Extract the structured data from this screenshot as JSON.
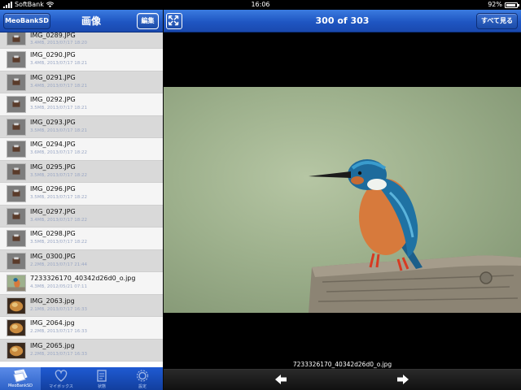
{
  "status": {
    "carrier": "SoftBank",
    "time": "16:06",
    "battery": "92%",
    "battery_level": 0.92
  },
  "left_nav": {
    "back_label": "MeoBankSD",
    "title": "画像",
    "edit_label": "編集"
  },
  "right_nav": {
    "counter": "300 of 303",
    "see_all_label": "すべて見る"
  },
  "files": [
    {
      "name": "IMG_0289.JPG",
      "meta": "3.4MB, 2013/07/17 18:20",
      "thumb": "gray"
    },
    {
      "name": "IMG_0290.JPG",
      "meta": "3.4MB, 2013/07/17 18:21",
      "thumb": "gray"
    },
    {
      "name": "IMG_0291.JPG",
      "meta": "3.4MB, 2013/07/17 18:21",
      "thumb": "gray"
    },
    {
      "name": "IMG_0292.JPG",
      "meta": "3.5MB, 2013/07/17 18:21",
      "thumb": "gray"
    },
    {
      "name": "IMG_0293.JPG",
      "meta": "3.5MB, 2013/07/17 18:21",
      "thumb": "gray"
    },
    {
      "name": "IMG_0294.JPG",
      "meta": "3.6MB, 2013/07/17 18:22",
      "thumb": "gray"
    },
    {
      "name": "IMG_0295.JPG",
      "meta": "3.5MB, 2013/07/17 18:22",
      "thumb": "gray"
    },
    {
      "name": "IMG_0296.JPG",
      "meta": "3.5MB, 2013/07/17 18:22",
      "thumb": "gray"
    },
    {
      "name": "IMG_0297.JPG",
      "meta": "3.4MB, 2013/07/17 18:22",
      "thumb": "gray"
    },
    {
      "name": "IMG_0298.JPG",
      "meta": "3.5MB, 2013/07/17 18:22",
      "thumb": "gray"
    },
    {
      "name": "IMG_0300.JPG",
      "meta": "2.2MB, 2013/07/17 21:44",
      "thumb": "gray"
    },
    {
      "name": "7233326170_40342d26d0_o.jpg",
      "meta": "4.3MB, 2012/05/21 07:11",
      "thumb": "bird"
    },
    {
      "name": "IMG_2063.jpg",
      "meta": "2.1MB, 2013/07/17 16:33",
      "thumb": "food"
    },
    {
      "name": "IMG_2064.jpg",
      "meta": "2.2MB, 2013/07/17 16:33",
      "thumb": "food"
    },
    {
      "name": "IMG_2065.jpg",
      "meta": "2.2MB, 2013/07/17 16:33",
      "thumb": "food"
    }
  ],
  "tabs": [
    {
      "label": "MeoBankSD",
      "icon": "sd-card-icon",
      "active": true
    },
    {
      "label": "マイボックス",
      "icon": "heart-icon",
      "active": false
    },
    {
      "label": "状態",
      "icon": "status-icon",
      "active": false
    },
    {
      "label": "設定",
      "icon": "gear-icon",
      "active": false
    }
  ],
  "viewer": {
    "filename": "7233326170_40342d26d0_o.jpg"
  },
  "colors": {
    "nav_blue": "#1f56c2",
    "list_alt": "#d9d9d9",
    "meta_text": "#9aa7c4"
  }
}
